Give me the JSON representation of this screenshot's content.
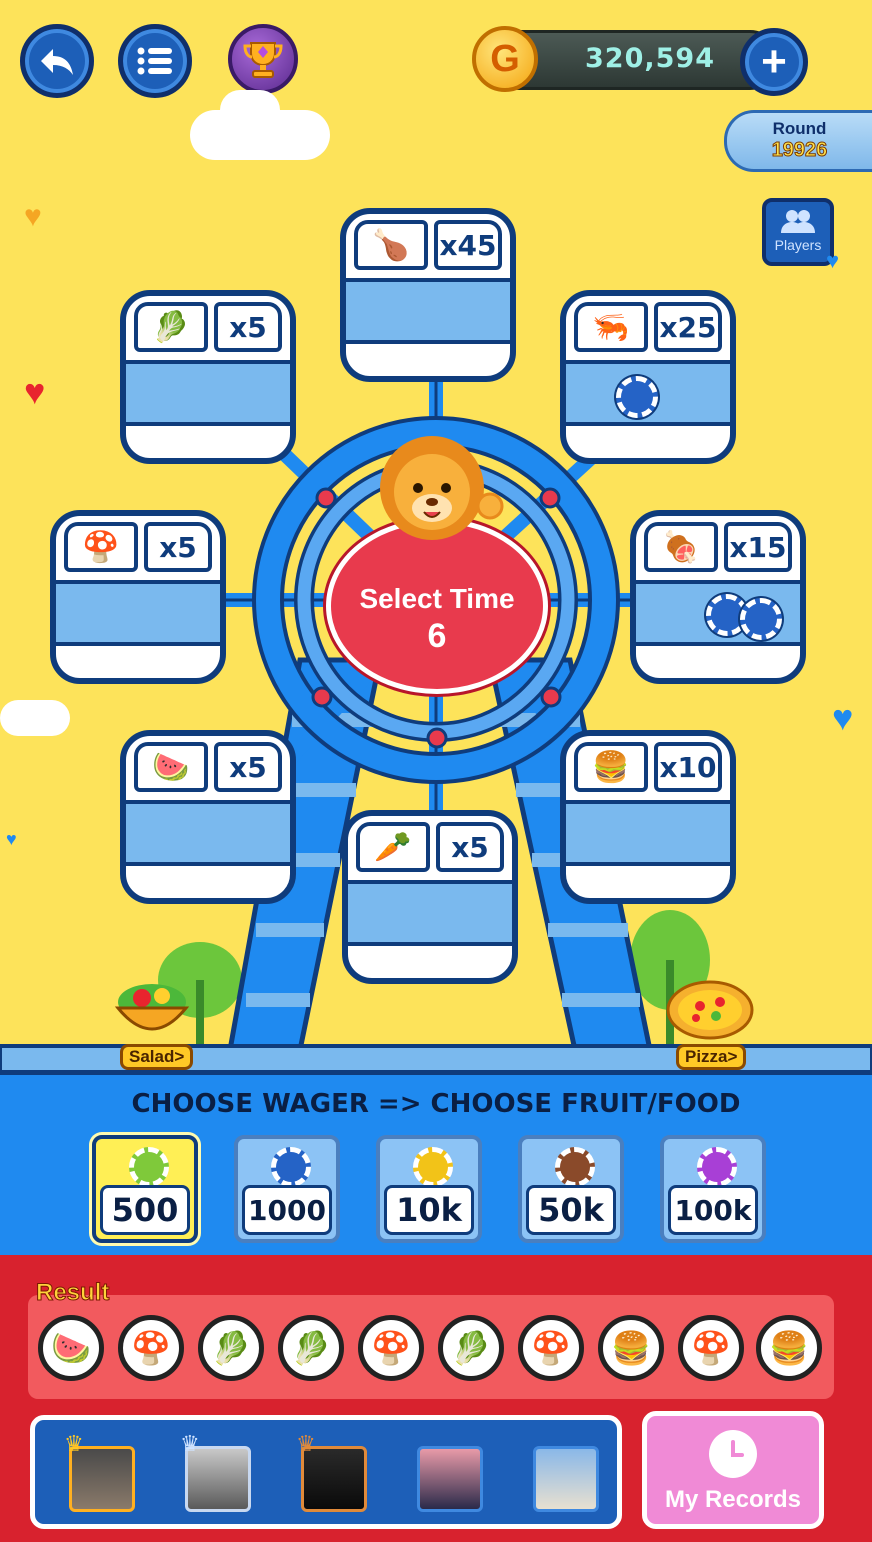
{
  "header": {
    "coins": "320,594",
    "coin_symbol": "G",
    "round_label": "Round",
    "round_number": "19926",
    "players_label": "Players"
  },
  "center": {
    "title": "Select Time",
    "countdown": "6"
  },
  "cabins": [
    {
      "food": "Chicken",
      "icon": "🍗",
      "multiplier": "x45",
      "chips": 0
    },
    {
      "food": "Shrimp",
      "icon": "🦐",
      "multiplier": "x25",
      "chips": 1
    },
    {
      "food": "Ham",
      "icon": "🍖",
      "multiplier": "x15",
      "chips": 2
    },
    {
      "food": "Burger",
      "icon": "🍔",
      "multiplier": "x10",
      "chips": 0
    },
    {
      "food": "Carrot",
      "icon": "🥕",
      "multiplier": "x5",
      "chips": 0
    },
    {
      "food": "Watermelon",
      "icon": "🍉",
      "multiplier": "x5",
      "chips": 0
    },
    {
      "food": "Mushroom",
      "icon": "🍄",
      "multiplier": "x5",
      "chips": 0
    },
    {
      "food": "Lettuce",
      "icon": "🥬",
      "multiplier": "x5",
      "chips": 0
    }
  ],
  "base": {
    "salad_label": "Salad>",
    "pizza_label": "Pizza>"
  },
  "wager_panel": {
    "title": "CHOOSE WAGER => CHOOSE FRUIT/FOOD",
    "options": [
      {
        "value": "500",
        "chip_color": "#7fc93a",
        "selected": true
      },
      {
        "value": "1000",
        "chip_color": "#2563c6",
        "selected": false
      },
      {
        "value": "10k",
        "chip_color": "#f2c318",
        "selected": false
      },
      {
        "value": "50k",
        "chip_color": "#8a4a2a",
        "selected": false
      },
      {
        "value": "100k",
        "chip_color": "#a83fd6",
        "selected": false
      }
    ]
  },
  "results": {
    "label": "Result",
    "items": [
      "🍉",
      "🍄",
      "🥬",
      "🥬",
      "🍄",
      "🥬",
      "🍄",
      "🍔",
      "🍄",
      "🍔"
    ]
  },
  "records_button": "My Records",
  "colors": {
    "background": "#fde35a",
    "accent_blue": "#1f8af0",
    "dark_blue": "#0f3c7c",
    "red": "#d8222e"
  }
}
